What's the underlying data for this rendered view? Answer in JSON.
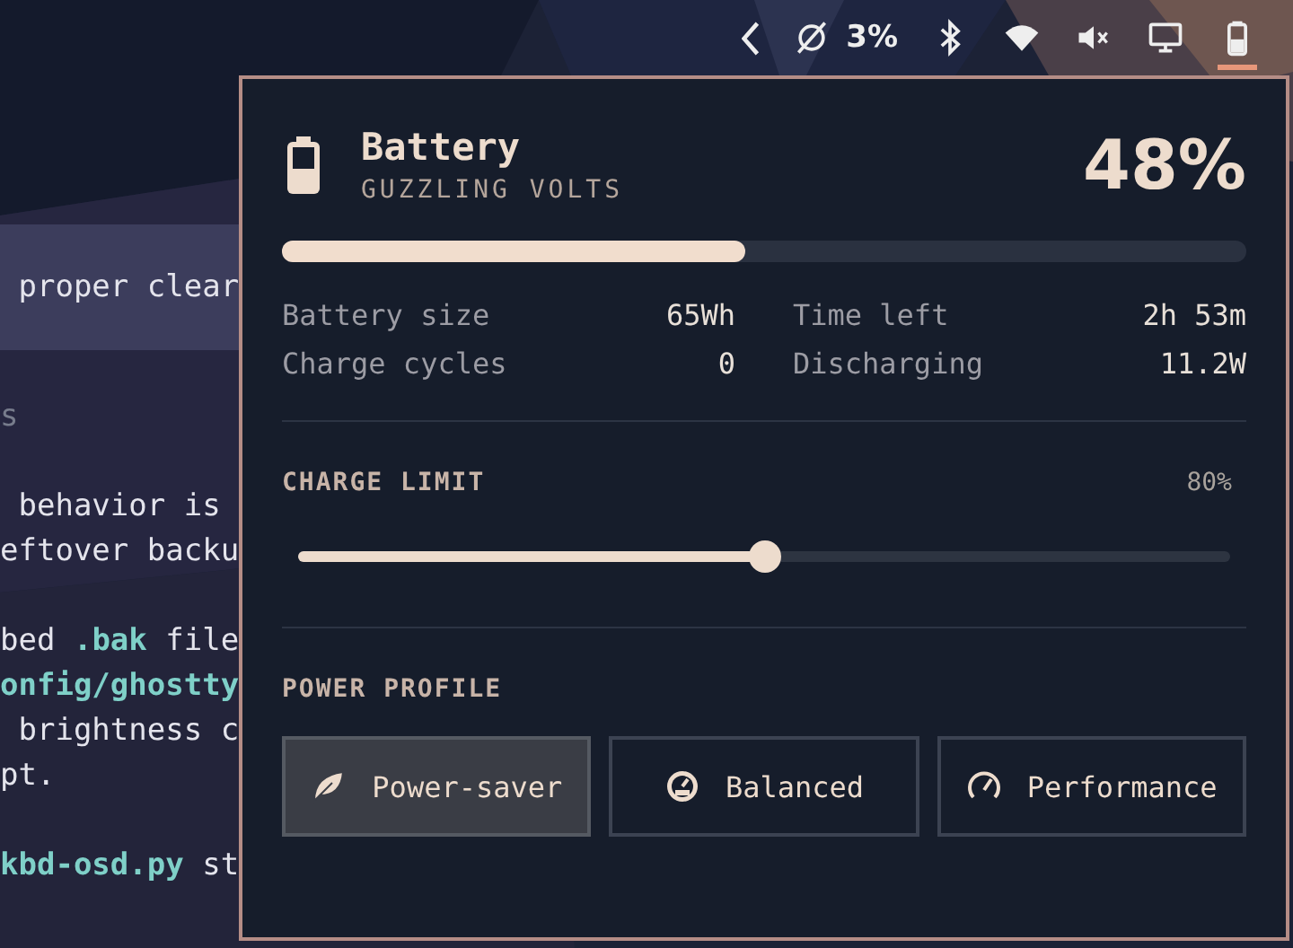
{
  "tray": [
    {
      "kind": "back",
      "selected": false
    },
    {
      "kind": "sync-off",
      "label": "3%",
      "selected": false
    },
    {
      "kind": "bluetooth",
      "selected": false
    },
    {
      "kind": "wifi",
      "selected": false
    },
    {
      "kind": "muted",
      "selected": false
    },
    {
      "kind": "display",
      "selected": false
    },
    {
      "kind": "battery",
      "selected": true
    }
  ],
  "terminal": {
    "lines": [
      {
        "kind": "highlight",
        "parts": [
          {
            "text": " proper clear",
            "code": false
          }
        ]
      },
      {
        "kind": "blank"
      },
      {
        "kind": "dim",
        "parts": [
          {
            "text": "s",
            "code": false
          }
        ]
      },
      {
        "kind": "blank"
      },
      {
        "kind": "text",
        "parts": [
          {
            "text": " behavior is",
            "code": false
          }
        ]
      },
      {
        "kind": "text",
        "parts": [
          {
            "text": "eftover backu",
            "code": false
          }
        ]
      },
      {
        "kind": "blank"
      },
      {
        "kind": "text",
        "parts": [
          {
            "text": "bed ",
            "code": false
          },
          {
            "text": ".bak",
            "code": true
          },
          {
            "text": " file",
            "code": false
          }
        ]
      },
      {
        "kind": "text",
        "parts": [
          {
            "text": "onfig/ghostty",
            "code": true
          }
        ]
      },
      {
        "kind": "text",
        "parts": [
          {
            "text": " brightness c",
            "code": false
          }
        ]
      },
      {
        "kind": "text",
        "parts": [
          {
            "text": "pt.",
            "code": false
          }
        ]
      },
      {
        "kind": "blank"
      },
      {
        "kind": "text",
        "parts": [
          {
            "text": "kbd-osd.py",
            "code": true
          },
          {
            "text": " st",
            "code": false
          }
        ]
      }
    ]
  },
  "panel": {
    "title": "Battery",
    "subtitle": "GUZZLING VOLTS",
    "percent": "48%",
    "level": 0.48,
    "stats": [
      {
        "label": "Battery size",
        "value": "65Wh"
      },
      {
        "label": "Time left",
        "value": "2h 53m"
      },
      {
        "label": "Charge cycles",
        "value": "0"
      },
      {
        "label": "Discharging",
        "value": "11.2W"
      }
    ],
    "charge_limit": {
      "label": "CHARGE LIMIT",
      "reading": "80%",
      "level": 0.5
    },
    "power_profile": {
      "label": "POWER PROFILE",
      "options": [
        {
          "kind": "leaf",
          "label": "Power-saver",
          "selected": true
        },
        {
          "kind": "balanced",
          "label": "Balanced",
          "selected": false
        },
        {
          "kind": "performance",
          "label": "Performance",
          "selected": false
        }
      ]
    }
  }
}
